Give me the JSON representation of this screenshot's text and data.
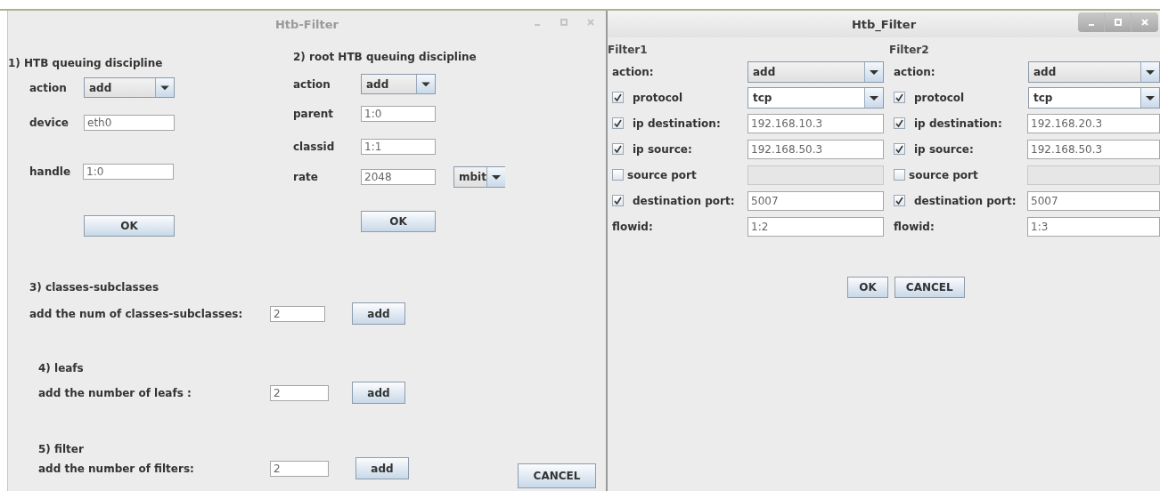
{
  "htb_window": {
    "title": "Htb-Filter",
    "active": false,
    "qdisc": {
      "heading": "1)  HTB queuing discipline",
      "action": {
        "label": "action",
        "value": "add"
      },
      "device": {
        "label": "device",
        "value": "eth0"
      },
      "handle": {
        "label": "handle",
        "value": "1:0"
      },
      "ok": "OK"
    },
    "root": {
      "heading": "2)  root HTB queuing discipline",
      "action": {
        "label": "action",
        "value": "add"
      },
      "parent": {
        "label": "parent",
        "value": "1:0"
      },
      "classid": {
        "label": "classid",
        "value": "1:1"
      },
      "rate": {
        "label": "rate",
        "value": "2048",
        "unit": "mbit"
      },
      "ok": "OK"
    },
    "counts": [
      {
        "heading": "3) classes-subclasses",
        "label": "add the num of classes-subclasses:",
        "value": "2",
        "button": "add"
      },
      {
        "heading": "4)  leafs",
        "label": "add the number of leafs :",
        "value": "2",
        "button": "add"
      },
      {
        "heading": "5) filter",
        "label": "add the number of filters:",
        "value": "2",
        "button": "add"
      }
    ],
    "cancel": "CANCEL"
  },
  "filter_window": {
    "title": "Htb_Filter",
    "active": true,
    "filters": [
      {
        "heading": "Filter1",
        "rows": [
          {
            "kind": "combo",
            "label": "action:",
            "value": "add"
          },
          {
            "kind": "check-combo",
            "label": "protocol",
            "checked": true,
            "value": "tcp"
          },
          {
            "kind": "check-field",
            "label": "ip destination:",
            "checked": true,
            "disabled": false,
            "value": "192.168.10.3"
          },
          {
            "kind": "check-field",
            "label": "ip source:",
            "checked": true,
            "disabled": false,
            "value": "192.168.50.3"
          },
          {
            "kind": "check-field",
            "label": "source port",
            "checked": false,
            "disabled": true
          },
          {
            "kind": "check-field",
            "label": "destination port:",
            "checked": true,
            "disabled": false,
            "value": "5007"
          },
          {
            "kind": "field",
            "label": "flowid:",
            "value": "1:2"
          }
        ]
      },
      {
        "heading": "Filter2",
        "rows": [
          {
            "kind": "combo",
            "label": "action:",
            "value": "add"
          },
          {
            "kind": "check-combo",
            "label": "protocol",
            "checked": true,
            "value": "tcp"
          },
          {
            "kind": "check-field",
            "label": "ip destination:",
            "checked": true,
            "disabled": false,
            "value": "192.168.20.3"
          },
          {
            "kind": "check-field",
            "label": "ip source:",
            "checked": true,
            "disabled": false,
            "value": "192.168.50.3"
          },
          {
            "kind": "check-field",
            "label": "source port",
            "checked": false,
            "disabled": true
          },
          {
            "kind": "check-field",
            "label": "destination port:",
            "checked": true,
            "disabled": false,
            "value": "5007"
          },
          {
            "kind": "field",
            "label": "flowid:",
            "value": "1:3"
          }
        ]
      }
    ],
    "buttons": [
      "OK",
      "CANCEL"
    ]
  }
}
